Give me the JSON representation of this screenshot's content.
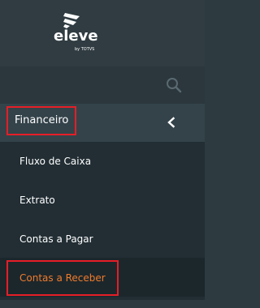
{
  "brand": {
    "logo_text": "eleve",
    "logo_subtext": "by TOTVS"
  },
  "search": {
    "icon": "search-icon"
  },
  "menu": {
    "parent_label": "Financeiro",
    "parent_icon": "chevron-left-icon",
    "items": [
      {
        "label": "Fluxo de Caixa"
      },
      {
        "label": "Extrato"
      },
      {
        "label": "Contas a Pagar"
      },
      {
        "label": "Contas a Receber"
      }
    ]
  },
  "colors": {
    "accent": "#f07b2b",
    "highlight_border": "#e61e27"
  }
}
